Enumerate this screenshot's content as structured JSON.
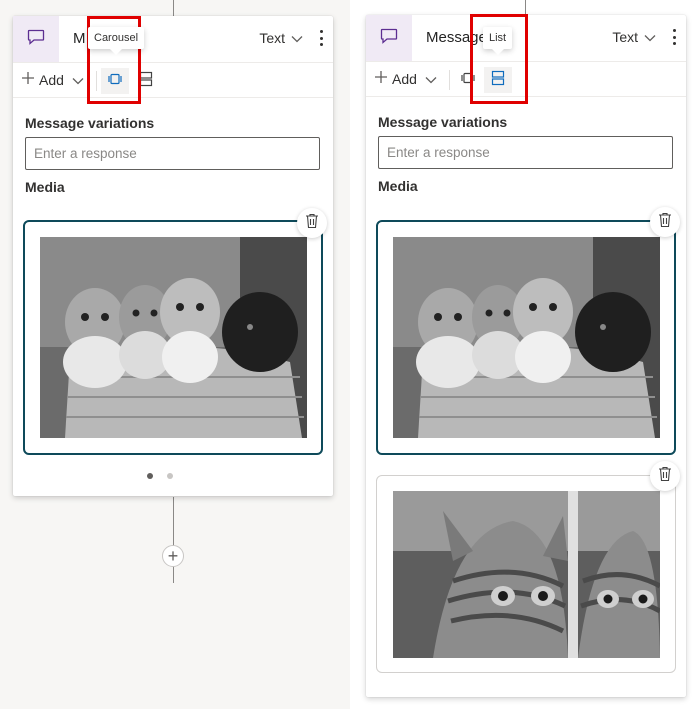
{
  "left_card": {
    "title": "M",
    "type_select": "Text",
    "add_label": "Add",
    "tooltip": "Carousel",
    "message_variations_label": "Message variations",
    "response_placeholder": "Enter a response",
    "media_label": "Media",
    "carousel_page": 1,
    "carousel_pages": 2
  },
  "right_card": {
    "title": "Message",
    "type_select": "Text",
    "add_label": "Add",
    "tooltip": "List",
    "message_variations_label": "Message variations",
    "response_placeholder": "Enter a response",
    "media_label": "Media"
  },
  "media_items": [
    {
      "name": "kittens-in-basket"
    },
    {
      "name": "kitten-with-reflection"
    }
  ],
  "colors": {
    "accent_header": "#f0eaf5",
    "message_icon": "#5c2e91",
    "focus_border": "#0e4a5a",
    "highlight": "#e00000"
  },
  "icons": {
    "message": "chat-bubble-icon",
    "carousel": "carousel-icon",
    "list": "list-icon",
    "delete": "trash-icon",
    "add": "plus-icon",
    "more": "more-vertical-icon"
  }
}
